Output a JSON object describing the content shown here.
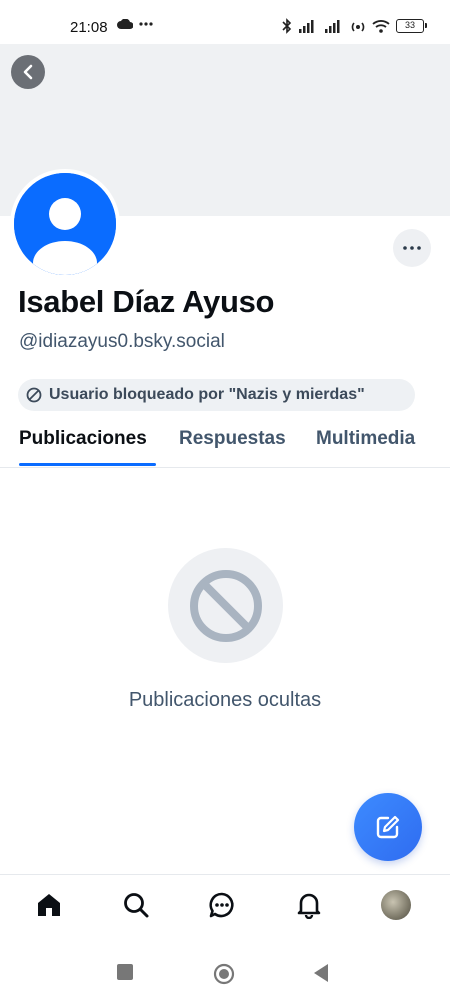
{
  "status_bar": {
    "time": "21:08",
    "battery": "33",
    "icons": [
      "cloud-icon",
      "more-dots-icon",
      "bluetooth-icon",
      "signal-icon",
      "signal-icon",
      "hotspot-icon",
      "wifi-icon",
      "battery-icon"
    ]
  },
  "header": {
    "back_icon": "chevron-left-icon",
    "more_icon": "more-horizontal-icon"
  },
  "profile": {
    "display_name": "Isabel Díaz Ayuso",
    "handle": "@idiazayus0.bsky.social",
    "blocked_label": "Usuario bloqueado por \"Nazis y mierdas\"",
    "avatar_color": "#0a6cff"
  },
  "tabs": [
    {
      "label": "Publicaciones",
      "active": true
    },
    {
      "label": "Respuestas",
      "active": false
    },
    {
      "label": "Multimedia",
      "active": false
    }
  ],
  "empty_state": {
    "icon": "blocked-icon",
    "text": "Publicaciones ocultas"
  },
  "fab": {
    "icon": "compose-icon"
  },
  "bottom_nav": [
    "home-icon",
    "search-icon",
    "chat-icon",
    "bell-icon",
    "profile-avatar"
  ],
  "colors": {
    "accent": "#0a6cff",
    "muted_text": "#42566c"
  }
}
